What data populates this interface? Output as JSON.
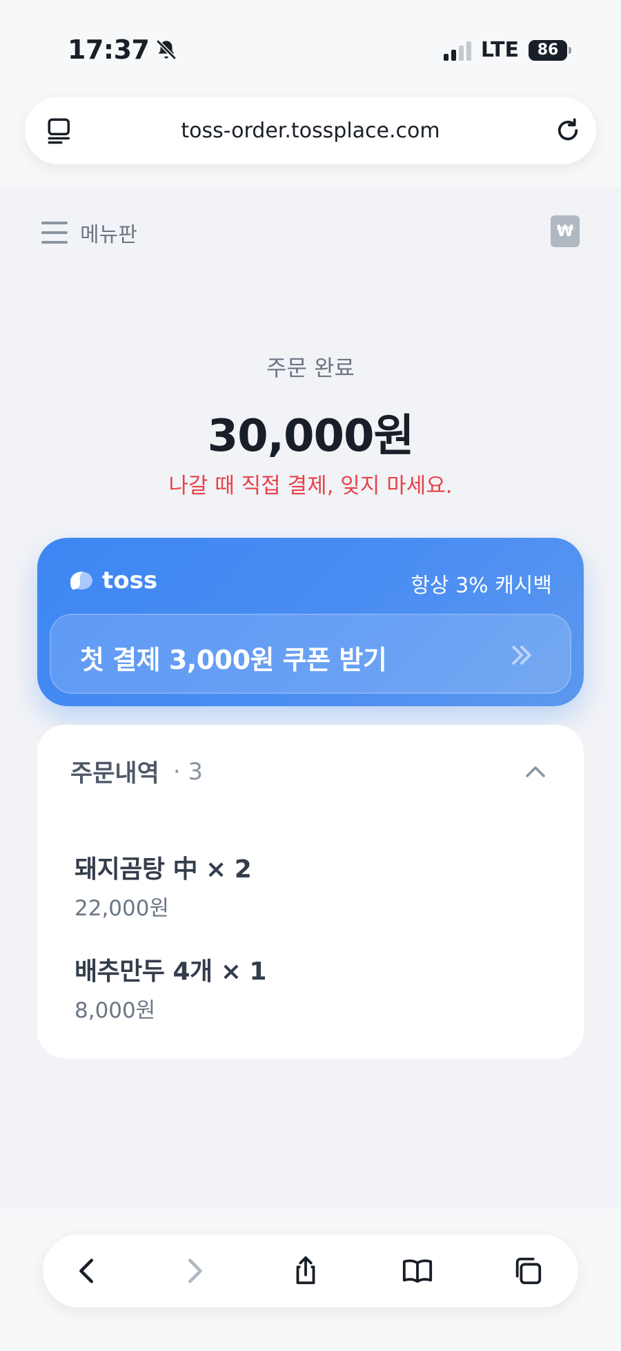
{
  "status_bar": {
    "time": "17:37",
    "network": "LTE",
    "battery": "86",
    "icons": [
      "bell-slash-icon",
      "signal-icon",
      "battery-icon"
    ]
  },
  "browser": {
    "url": "toss-order.tossplace.com",
    "icons": [
      "tab-layout-icon",
      "reload-icon"
    ]
  },
  "header": {
    "menu_label": "메뉴판",
    "receipt_symbol": "₩"
  },
  "summary": {
    "status": "주문 완료",
    "total": "30,000원",
    "warning": "나갈 때 직접 결제, 잊지 마세요."
  },
  "toss_card": {
    "brand": "toss",
    "tagline": "항상 3% 캐시백",
    "coupon_label": "첫 결제 3,000원 쿠폰 받기"
  },
  "order_list": {
    "title": "주문내역",
    "count": "· 3",
    "items": [
      {
        "name": "돼지곰탕 中 × 2",
        "price": "22,000원"
      },
      {
        "name": "배추만두 4개 × 1",
        "price": "8,000원"
      }
    ]
  },
  "toolbar": {
    "icons": [
      "back-icon",
      "forward-icon",
      "share-icon",
      "bookmarks-icon",
      "tabs-icon"
    ]
  },
  "colors": {
    "accent_blue": "#3182f6",
    "warning_red": "#e8424b",
    "background": "#f2f3f6",
    "text_primary": "#191f28",
    "text_secondary": "#6b7684"
  }
}
